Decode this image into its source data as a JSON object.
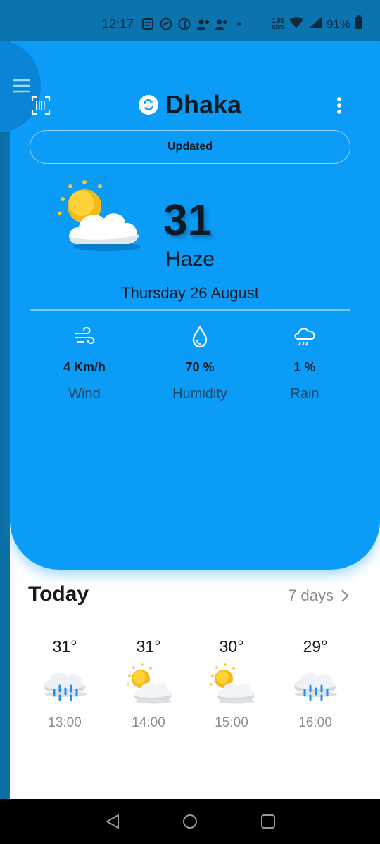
{
  "status_bar": {
    "time": "12:17",
    "speed_value": "1.01",
    "speed_unit": "KB/S",
    "battery": "91%",
    "icons": [
      "notes-icon",
      "messenger-icon",
      "facebook-icon",
      "add-person-icon",
      "add-person-icon",
      "dot-icon",
      "wifi-icon",
      "signal-icon",
      "battery-icon"
    ]
  },
  "header": {
    "city": "Dhaka",
    "updated_label": "Updated"
  },
  "current": {
    "temperature": "31",
    "condition": "Haze",
    "date": "Thursday 26 August",
    "icon": "partly-cloudy-icon"
  },
  "stats": [
    {
      "icon": "wind-icon",
      "value": "4 Km/h",
      "label": "Wind"
    },
    {
      "icon": "humidity-icon",
      "value": "70 %",
      "label": "Humidity"
    },
    {
      "icon": "rain-icon",
      "value": "1 %",
      "label": "Rain"
    }
  ],
  "today": {
    "title": "Today",
    "seven_days_label": "7 days",
    "hours": [
      {
        "temp": "31°",
        "time": "13:00",
        "icon": "rain-cloud-icon"
      },
      {
        "temp": "31°",
        "time": "14:00",
        "icon": "partly-cloudy-icon"
      },
      {
        "temp": "30°",
        "time": "15:00",
        "icon": "partly-cloudy-icon"
      },
      {
        "temp": "29°",
        "time": "16:00",
        "icon": "rain-cloud-icon"
      }
    ]
  },
  "colors": {
    "card": "#0a9cf6",
    "status_bar": "#0b73ad",
    "text_dark": "#0c1a26",
    "muted": "#8f8f8f"
  }
}
